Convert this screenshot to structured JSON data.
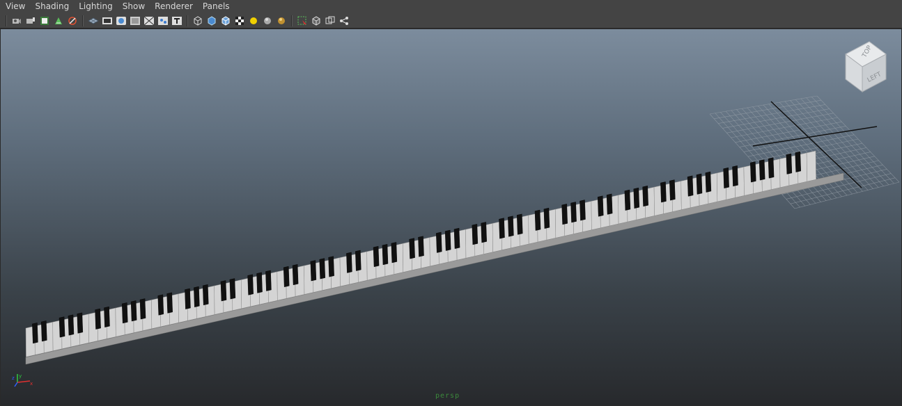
{
  "menu": [
    "View",
    "Shading",
    "Lighting",
    "Show",
    "Renderer",
    "Panels"
  ],
  "toolbar": {
    "groups": [
      [
        "camera-attributes-icon",
        "camera-bookmark-icon",
        "image-plane-icon",
        "2d-pan-zoom-icon",
        "grease-pencil-icon"
      ],
      [
        "grid-toggle-icon",
        "film-gate-icon",
        "resolution-gate-icon",
        "gate-mask-icon",
        "field-chart-icon",
        "safe-action-icon",
        "safe-title-icon"
      ],
      [
        "wireframe-icon",
        "smooth-shade-icon",
        "wireframe-on-shaded-icon",
        "textured-icon",
        "use-all-lights-icon",
        "shadows-icon",
        "screen-space-ao-icon"
      ],
      [
        "select-camera-icon",
        "isolate-select-icon",
        "xray-icon",
        "share-icon"
      ]
    ]
  },
  "viewport": {
    "camera_label": "persp",
    "viewcube": {
      "top_label": "TOP",
      "left_label": "LEFT"
    },
    "axis_labels": {
      "x": "x",
      "y": "y",
      "z": "z"
    }
  },
  "colors": {
    "bg_top": "#7c8c9d",
    "bg_bottom": "#27292c",
    "white_key": "#d4d4d4",
    "black_key": "#111111",
    "grid": "#9aa2ab"
  }
}
